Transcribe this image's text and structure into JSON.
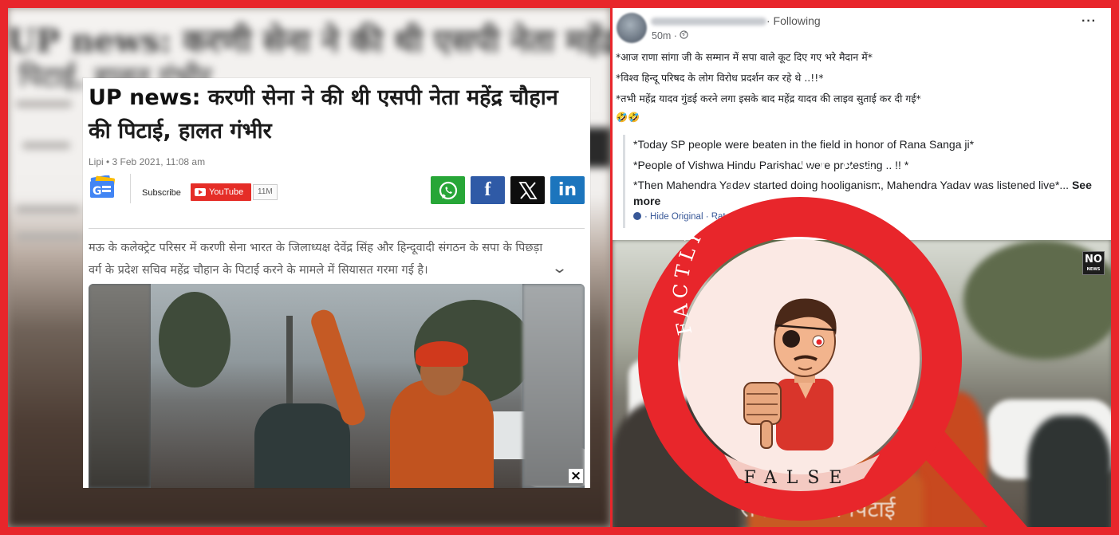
{
  "colors": {
    "frame": "#e8262b",
    "youtube": "#e52d27",
    "whatsapp": "#27a637",
    "facebook": "#2f5aa6",
    "linkedin": "#1c75bd",
    "link": "#385898"
  },
  "left_background": {
    "headline_blurred_line1": "UP news: करणी सेना ने की थी एसपी नेता महेंद्र चौहान की",
    "headline_blurred_line2": "पिटाई, हालत गंभीर"
  },
  "article": {
    "headline_prefix": "UP news:",
    "headline_rest": " करणी सेना ने की थी एसपी नेता महेंद्र चौहान की पिटाई, हालत गंभीर",
    "byline": "Lipi • 3 Feb 2021, 11:08 am",
    "google_news_icon": "google-news-icon",
    "subscribe_label": "Subscribe",
    "youtube_label": "YouTube",
    "youtube_count": "11M",
    "share": {
      "whatsapp": "whatsapp-icon",
      "facebook": "f",
      "x": "x-icon",
      "linkedin": "in"
    },
    "summary": "मऊ के कलेक्ट्रेट परिसर में करणी सेना भारत के जिलाध्यक्ष देवेंद्र सिंह और हिन्दूवादी संगठन के सपा के पिछड़ा वर्ग के प्रदेश सचिव महेंद्र चौहान के पिटाई करने के मामले में सियासत गरमा गई है।",
    "expand_icon": "⌄",
    "video_close": "×"
  },
  "post": {
    "following": "· Following",
    "time": "50m · ",
    "more": "···",
    "lines": [
      "*आज राणा सांगा जी के सम्मान में सपा वाले कूट दिए गए भरे मैदान में*",
      "*विश्व हिन्दू परिषद के लोग विरोध प्रदर्शन कर रहे थे ..!!*",
      "*तभी महेंद्र यादव गुंडई करने लगा इसके बाद महेंद्र यादव की लाइव सुताई कर दी गई*",
      "🤣🤣"
    ],
    "translation": [
      "*Today SP people were beaten in the field in honor of Rana Sanga ji*",
      "*People of Vishwa Hindu Parishad were protesting .. !! *",
      "*Then Mahendra Yadav started doing hooliganism, Mahendra Yadav was listened live*..."
    ],
    "see_more": "See more",
    "hide_original": "· Hide Original · Rate this translation",
    "video_logo": "NO",
    "video_logo_sub": "NEWS",
    "video_caption": "सपा नेता की पिटाई"
  },
  "stamp": {
    "arc_text": "FACTLY FACT - CHECK",
    "verdict": "FALSE"
  }
}
